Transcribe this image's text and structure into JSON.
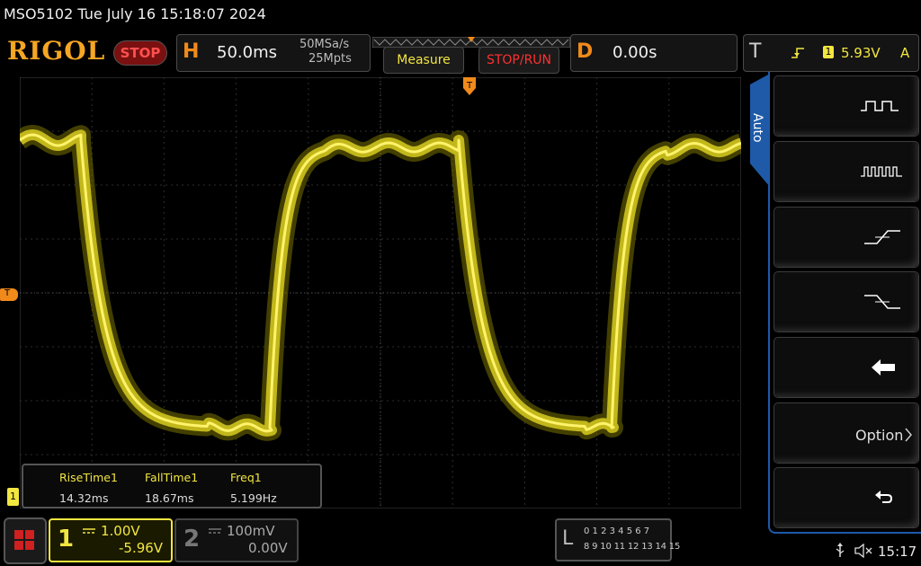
{
  "status": {
    "title": "MSO5102  Tue July 16 15:18:07 2024"
  },
  "brand": {
    "logo": "RIGOL",
    "stop_label": "STOP"
  },
  "horizontal": {
    "letter": "H",
    "timebase": "50.0ms",
    "sample_rate": "50MSa/s",
    "mem_depth": "25Mpts"
  },
  "buttons": {
    "measure": "Measure",
    "stop_run": "STOP/RUN"
  },
  "delay": {
    "letter": "D",
    "value": "0.00s"
  },
  "trigger": {
    "letter": "T",
    "channel": "1",
    "level": "5.93V",
    "mode": "A",
    "side_label": "Auto",
    "marker": "T"
  },
  "right_panel": {
    "option_label": "Option"
  },
  "measurements": [
    {
      "name": "RiseTime1",
      "value": "14.32ms"
    },
    {
      "name": "FallTime1",
      "value": "18.67ms"
    },
    {
      "name": "Freq1",
      "value": "5.199Hz"
    }
  ],
  "channel1": {
    "number": "1",
    "scale": "1.00V",
    "offset": "-5.96V",
    "marker": "1"
  },
  "channel2": {
    "number": "2",
    "scale": "100mV",
    "offset": "0.00V"
  },
  "logic": {
    "letter": "L",
    "row1": "0 1 2 3  4 5 6 7",
    "row2": "8 9 10 11 12 13 14 15"
  },
  "clock": {
    "time": "15:17"
  },
  "colors": {
    "ch1": "#f2e640",
    "accent_orange": "#f08a1a",
    "panel_blue": "#1e5aa8",
    "stop_red": "#ff3030"
  },
  "icons": [
    "usb-icon",
    "speaker-mute-icon",
    "pulse-icon",
    "pulse-train-icon",
    "rise-edge-icon",
    "fall-edge-icon",
    "back-arrow-icon",
    "return-icon",
    "menu-grid-icon"
  ]
}
